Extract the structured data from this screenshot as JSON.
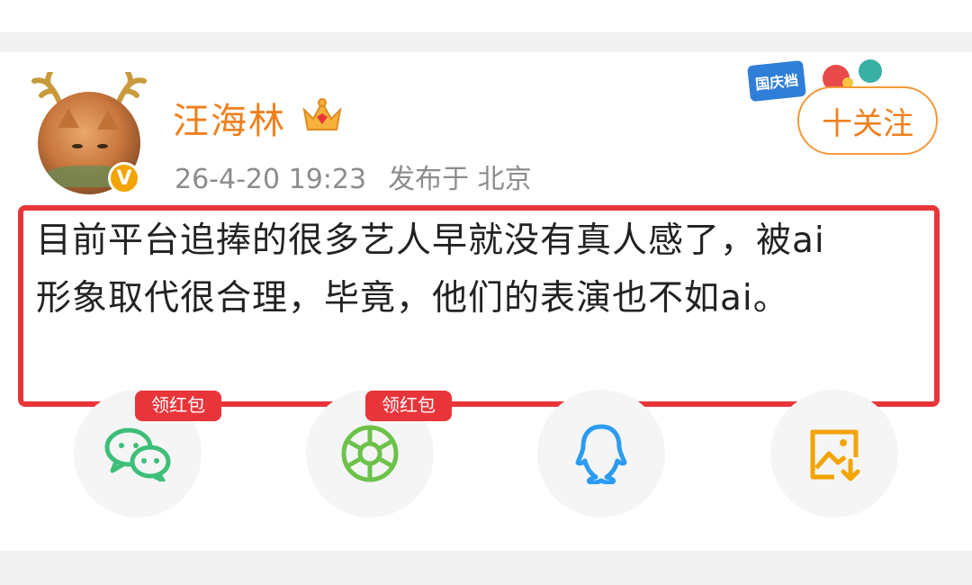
{
  "post": {
    "username": "汪海林",
    "timestamp": "26-4-20 19:23",
    "location": "发布于 北京",
    "follow_label": "十关注",
    "text_line1": "目前平台追捧的很多艺人早就没有真人感了，被ai",
    "text_line2": "形象取代很合理，毕竟，他们的表演也不如ai。",
    "verified_mark": "V",
    "event_tag": "国庆档"
  },
  "share": {
    "badge_label": "领红包",
    "items": [
      {
        "icon": "wechat-icon",
        "has_badge": true
      },
      {
        "icon": "moments-icon",
        "has_badge": true
      },
      {
        "icon": "qq-icon",
        "has_badge": false
      },
      {
        "icon": "save-image-icon",
        "has_badge": false
      }
    ]
  },
  "colors": {
    "username": "#f07f1c",
    "highlight_border": "#e8353a",
    "wechat": "#3dbf79",
    "moments": "#6cc24a",
    "qq": "#2b9cf2",
    "save": "#f2a400"
  }
}
